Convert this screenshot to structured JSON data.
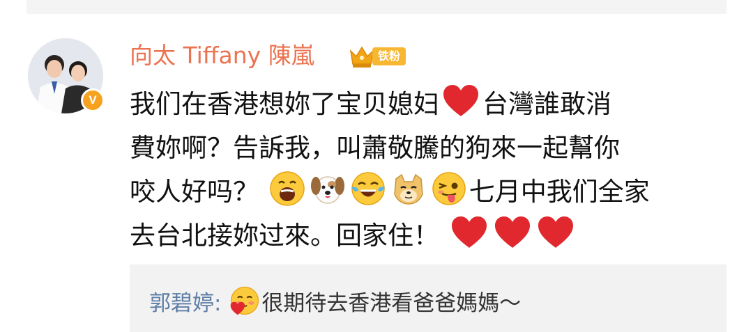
{
  "comment": {
    "username": "向太 Tiffany 陳嵐",
    "badge_label": "铁粉",
    "verified_symbol": "V",
    "segments": {
      "l1a": "我们在香港想妳了宝贝媳妇",
      "l1b": "台灣誰敢消",
      "l2": "費妳啊？告訴我，叫蕭敬騰的狗來一起幫你",
      "l3a": "咬人好吗？",
      "l3b": "七月中我们全家",
      "l4": "去台北接妳过來。回家住！"
    },
    "emojis": [
      "heart",
      "laughing-face",
      "dog-face",
      "tears-of-joy-face",
      "doge-face",
      "tongue-wink-face",
      "heart",
      "heart",
      "heart"
    ]
  },
  "reply": {
    "author": "郭碧婷",
    "separator": ": ",
    "emoji": "love-face",
    "text": "很期待去香港看爸爸媽媽～"
  },
  "colors": {
    "username": "#eb7350",
    "reply_author": "#5e7da6",
    "badge": "#f7b733",
    "heart": "#e0282e"
  }
}
